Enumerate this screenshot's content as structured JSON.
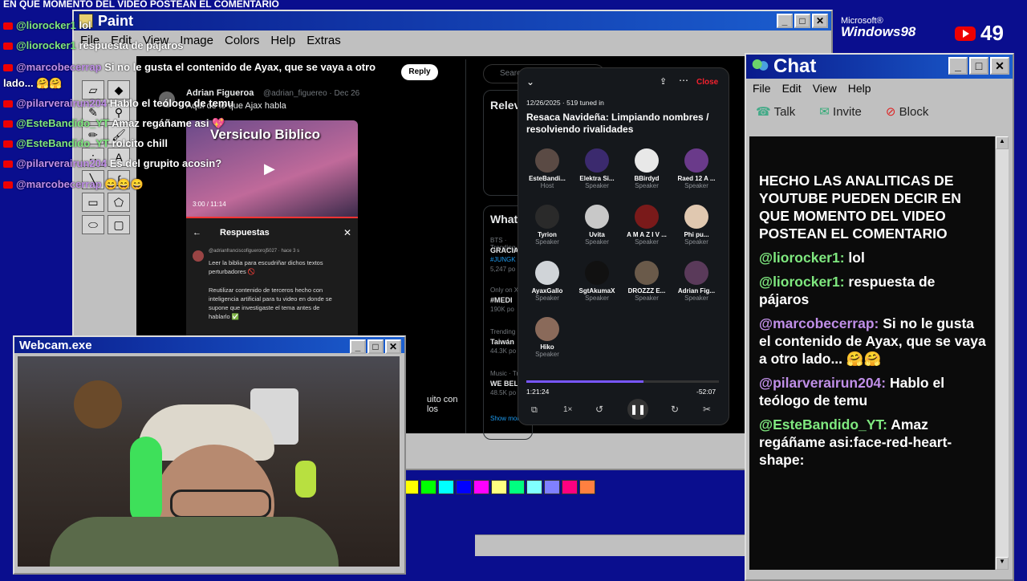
{
  "ticker": "EN QUE MOMENTO DEL VIDEO POSTEAN EL COMENTARIO",
  "overlay_chat": [
    {
      "user": "@liorocker1",
      "text": "lol"
    },
    {
      "user": "@liorocker1",
      "text": "respuesta de pájaros"
    },
    {
      "user": "@marcobecerrap",
      "text": "Si no le gusta el contenido de Ayax, que se vaya a otro lado... 🤗🤗"
    },
    {
      "user": "@pilarverairun204",
      "text": "Hablo el teólogo de temu"
    },
    {
      "user": "@EsteBandido_YT",
      "text": "Amaz regáñame asi 💖"
    },
    {
      "user": "@EsteBandido_YT",
      "text": "rolcito chill"
    },
    {
      "user": "@pilarverairun204",
      "text": "Es del grupito acosin?"
    },
    {
      "user": "@marcobecerrap",
      "text": "😄😄😄"
    }
  ],
  "paint": {
    "title": "Paint",
    "menu": [
      "File",
      "Edit",
      "View",
      "Image",
      "Colors",
      "Help",
      "Extras"
    ],
    "palette": [
      "#ffff00",
      "#00ff00",
      "#00ffff",
      "#0000ff",
      "#ff00ff",
      "#ffff80",
      "#00ff80",
      "#80ffff",
      "#8080ff",
      "#ff0080",
      "#ff8040"
    ]
  },
  "xpost": {
    "reply_label": "Reply",
    "search_placeholder": "Search",
    "author": "Adrian Figueroa",
    "handle": "@adrian_figuereo · Dec 26",
    "body": "Aquí de lo que Ajax habla",
    "video_time": "3:00 / 11:14",
    "video_overlay": "Versiculo Biblico",
    "replies_title": "Respuestas",
    "reply_handle": "@adrianfranciscofigueroroj5027 · hace 3 s",
    "reply_text1": "Leer la biblia para escudriñar dichos textos perturbadores 🚫",
    "reply_text2": "Reutilizar contenido de terceros hecho con inteligencia artificial para tu video en donde se supone que investigaste el tema antes de hablarlo ✅",
    "side_snippet": "uito con los",
    "trends_title": "Relev",
    "whats": "What",
    "trend1_meta": "BTS · Trending",
    "trend1": "GRACIA",
    "trend1b": "#JUNGK",
    "trend1_count": "5,247 po",
    "trend2_meta": "Only on X",
    "trend2": "#MEDI",
    "trend2_count": "190K po",
    "trend3_meta": "Trending",
    "trend3": "Taiwán",
    "trend3_count": "44.3K po",
    "trend4_meta": "Music · Tr",
    "trend4": "WE BEL",
    "trend4_count": "48.5K po",
    "show_more": "Show more"
  },
  "spaces": {
    "close": "Close",
    "meta": "12/26/2025 · 519 tuned in",
    "title": "Resaca Navideña: Limpiando nombres / resolviendo rivalidades",
    "people": [
      {
        "name": "EsteBandi...",
        "role": "Host",
        "color": "#5a4a44"
      },
      {
        "name": "Elektra Si...",
        "role": "Speaker",
        "color": "#3b2a6e"
      },
      {
        "name": "BBirdyd",
        "role": "Speaker",
        "color": "#e8e8e8"
      },
      {
        "name": "Raed 12 A ...",
        "role": "Speaker",
        "color": "#6a3a8a"
      },
      {
        "name": "Tyrion",
        "role": "Speaker",
        "color": "#2a2a2a"
      },
      {
        "name": "Uvita",
        "role": "Speaker",
        "color": "#c8c8c8"
      },
      {
        "name": "A M A Z I V ...",
        "role": "Speaker",
        "color": "#7a1a1a"
      },
      {
        "name": "Phi pu...",
        "role": "Speaker",
        "color": "#e0c8b0"
      },
      {
        "name": "AyaxGallo",
        "role": "Speaker",
        "color": "#d0d4d8"
      },
      {
        "name": "SgtAkumaX",
        "role": "Speaker",
        "color": "#111111"
      },
      {
        "name": "DROZZZ E...",
        "role": "Speaker",
        "color": "#6a5a4a"
      },
      {
        "name": "Adrian Fig...",
        "role": "Speaker",
        "color": "#5a3a5a"
      },
      {
        "name": "Hiko",
        "role": "Speaker",
        "color": "#8a6a5a"
      }
    ],
    "elapsed": "1:21:24",
    "remaining": "-52:07",
    "progress": 0.61,
    "speed": "1×"
  },
  "webcam": {
    "title": "Webcam.exe"
  },
  "win98": {
    "brand_top": "Microsoft®",
    "brand": "Windows98"
  },
  "counter": "49",
  "chat": {
    "title": "Chat",
    "menu": [
      "File",
      "Edit",
      "View",
      "Help"
    ],
    "tools": [
      "Talk",
      "Invite",
      "Block"
    ],
    "messages": [
      {
        "user": "",
        "text": "HECHO LAS ANALITICAS DE YOUTUBE PUEDEN DECIR EN QUE MOMENTO DEL VIDEO POSTEAN EL COMENTARIO"
      },
      {
        "user": "@liorocker1:",
        "text": "lol"
      },
      {
        "user": "@liorocker1:",
        "text": "respuesta de pájaros"
      },
      {
        "user": "@marcobecerrap:",
        "text": "Si no le gusta el contenido de Ayax, que se vaya a otro lado... 🤗🤗"
      },
      {
        "user": "@pilarverairun204:",
        "text": "Hablo el teólogo de temu"
      },
      {
        "user": "@EsteBandido_YT:",
        "text": "Amaz regáñame asi:face-red-heart-shape:"
      }
    ]
  }
}
